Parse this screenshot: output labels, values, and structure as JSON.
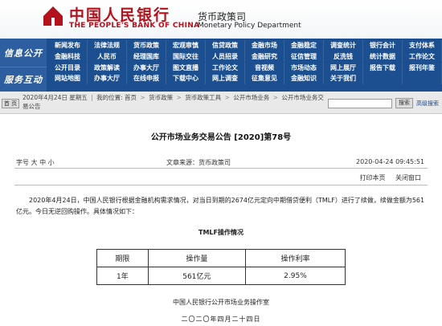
{
  "header": {
    "logo_cn": "中国人民银行",
    "logo_en": "THE PEOPLE'S BANK OF CHINA",
    "dept_cn": "货币政策司",
    "dept_en": "Monetary Policy Department"
  },
  "nav": {
    "side_1": "信息公开",
    "side_2": "服务互动",
    "rows": [
      [
        "新闻发布",
        "法律法规",
        "货币政策",
        "宏观审慎",
        "信贷政策",
        "金融市场",
        "金融稳定",
        "调查统计",
        "银行会计",
        "支付体系"
      ],
      [
        "金融科技",
        "人民币",
        "经理国库",
        "国际交往",
        "人员招录",
        "金融研究",
        "征信管理",
        "反洗钱",
        "统计数据",
        "工作论文"
      ],
      [
        "公开目录",
        "政策解读",
        "办事大厅",
        "图文直播",
        "工作论文",
        "音视频",
        "市场动态",
        "网上展厅",
        "报告下载",
        "报刊年鉴"
      ],
      [
        "网站地图",
        "办事大厅",
        "在线申报",
        "下载中心",
        "网上调查",
        "征集意见",
        "金融知识",
        "关于我们",
        "",
        ""
      ]
    ]
  },
  "breadcrumb": {
    "home_label": "首 页",
    "date_text": "2020年4月24日 星期五",
    "location_label": "我的位置:",
    "items": [
      "首页",
      "货币政策",
      "货币政策工具",
      "公开市场业务",
      "公开市场业务交易公告"
    ],
    "search_button": "搜索",
    "advanced_search": "高级搜索"
  },
  "article": {
    "title": "公开市场业务交易公告 [2020]第78号",
    "size_label": "字号",
    "size_options": [
      "大",
      "中",
      "小"
    ],
    "source": "文章来源：货币政策司",
    "date": "2020-04-24 09:45:51",
    "print_label": "打印本页",
    "close_label": "关闭窗口",
    "body": "2020年4月24日，中国人民银行根据金融机构需求情况，对当日到期的2674亿元定向中期借贷便利（TMLF）进行了续做，续做金额为561亿元。今日无逆回购操作。具体情况如下：",
    "table_title": "TMLF操作情况",
    "table_headers": [
      "期限",
      "操作量",
      "操作利率"
    ],
    "table_rows": [
      [
        "1年",
        "561亿元",
        "2.95%"
      ]
    ],
    "footer_org": "中国人民银行公开市场业务操作室",
    "footer_date": "二〇二〇年四月二十四日"
  },
  "colors": {
    "brand_red": "#b3121c",
    "nav_blue": "#1c4f8f"
  }
}
